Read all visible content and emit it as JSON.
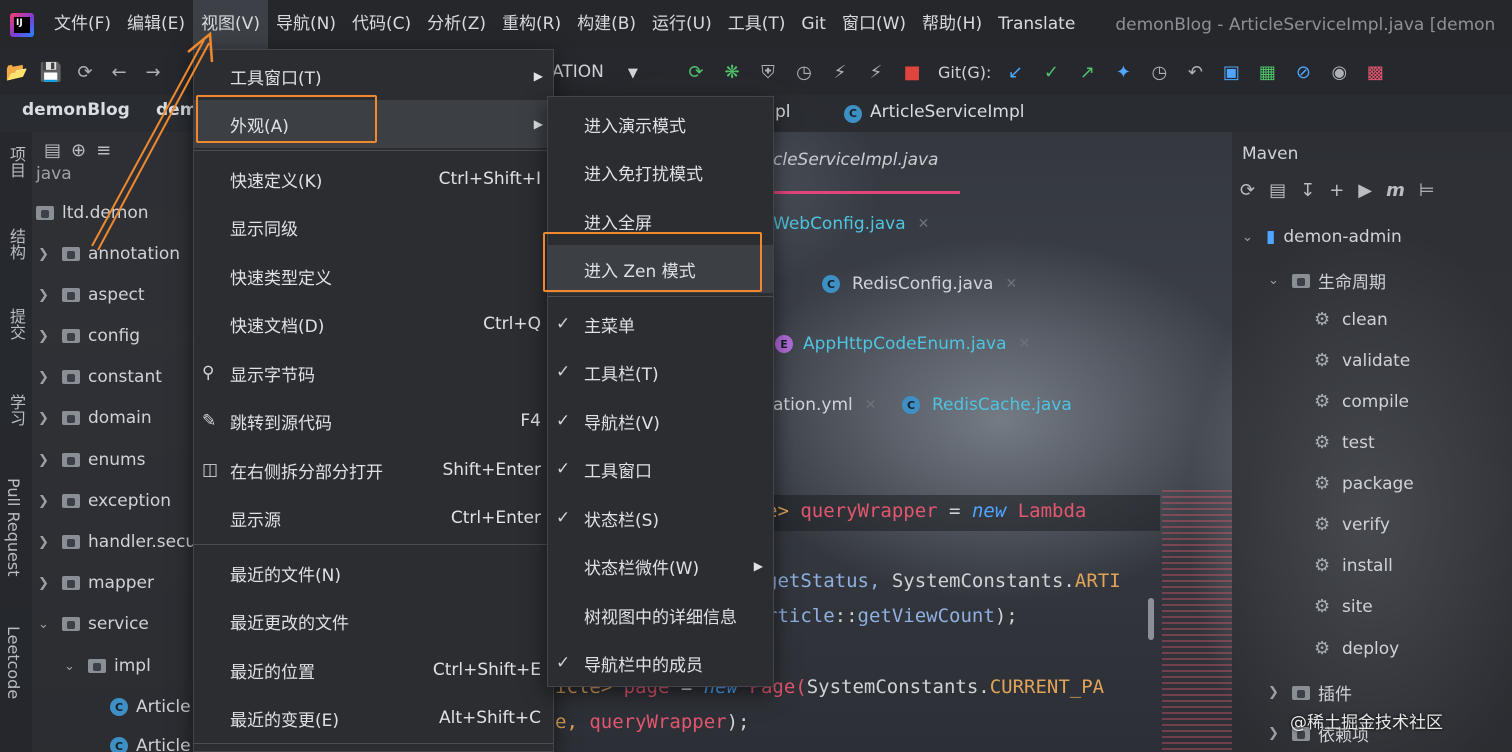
{
  "menubar": {
    "logo_text": "IJ",
    "items": [
      "文件(F)",
      "编辑(E)",
      "视图(V)",
      "导航(N)",
      "代码(C)",
      "分析(Z)",
      "重构(R)",
      "构建(B)",
      "运行(U)",
      "工具(T)",
      "Git",
      "窗口(W)",
      "帮助(H)",
      "Translate"
    ],
    "active_item": "视图(V)",
    "window_title": "demonBlog - ArticleServiceImpl.java [demon"
  },
  "toolbar": {
    "run_config": "ATION",
    "git_label": "Git(G):"
  },
  "breadcrumb": {
    "project": "demonBlog",
    "module": "dem",
    "partial": "pl",
    "class": "ArticleServiceImpl"
  },
  "left_strip": {
    "tabs": [
      "项目",
      "结构",
      "提交",
      "学习",
      "Pull Request",
      "Leetcode"
    ]
  },
  "project_tree": {
    "top_partial": "java",
    "root": "ltd.demon",
    "folders": [
      "annotation",
      "aspect",
      "config",
      "constant",
      "domain",
      "enums",
      "exception",
      "handler.secu",
      "mapper",
      "service"
    ],
    "sub": "impl",
    "files": [
      "Article",
      "Article"
    ]
  },
  "editor": {
    "tabs": [
      {
        "name": "cleServiceImpl.java"
      },
      {
        "name": "WebConfig.java"
      },
      {
        "name": "RedisConfig.java"
      },
      {
        "name": "AppHttpCodeEnum.java"
      },
      {
        "name": "ation.yml"
      },
      {
        "name": "RedisCache.java"
      }
    ],
    "code": {
      "l1_a": "e> ",
      "l1_b": "queryWrapper",
      "l1_c": " = ",
      "l1_d": "new",
      "l1_e": " Lambda",
      "l2_a": "getStatus, ",
      "l2_b": "SystemConstants.",
      "l2_c": "ARTI",
      "l3_a": "rticle",
      "l3_b": "::",
      "l3_c": "getViewCount",
      "l3_d": ");",
      "l4_a": "icle> ",
      "l4_b": "page",
      "l4_c": " = ",
      "l4_d": "new",
      "l4_e": " Page(",
      "l4_f": "SystemConstants.",
      "l4_g": "CURRENT_PA",
      "l5_a": "e, ",
      "l5_b": "queryWrapper",
      "l5_c": ");"
    }
  },
  "view_menu": {
    "items": [
      {
        "label": "工具窗口(T)",
        "shortcut": "",
        "submenu": true
      },
      {
        "label": "外观(A)",
        "shortcut": "",
        "submenu": true
      },
      {
        "label": "快速定义(K)",
        "shortcut": "Ctrl+Shift+I"
      },
      {
        "label": "显示同级",
        "shortcut": ""
      },
      {
        "label": "快速类型定义",
        "shortcut": ""
      },
      {
        "label": "快速文档(D)",
        "shortcut": "Ctrl+Q"
      },
      {
        "label": "显示字节码",
        "shortcut": ""
      },
      {
        "label": "跳转到源代码",
        "shortcut": "F4"
      },
      {
        "label": "在右侧拆分部分打开",
        "shortcut": "Shift+Enter"
      },
      {
        "label": "显示源",
        "shortcut": "Ctrl+Enter"
      },
      {
        "label": "最近的文件(N)",
        "shortcut": ""
      },
      {
        "label": "最近更改的文件",
        "shortcut": ""
      },
      {
        "label": "最近的位置",
        "shortcut": "Ctrl+Shift+E"
      },
      {
        "label": "最近的变更(E)",
        "shortcut": "Alt+Shift+C"
      }
    ]
  },
  "appearance_menu": {
    "items": [
      {
        "label": "进入演示模式",
        "checked": false
      },
      {
        "label": "进入免打扰模式",
        "checked": false
      },
      {
        "label": "进入全屏",
        "checked": false
      },
      {
        "label": "进入 Zen 模式",
        "checked": false
      },
      {
        "label": "主菜单",
        "checked": true
      },
      {
        "label": "工具栏(T)",
        "checked": true
      },
      {
        "label": "导航栏(V)",
        "checked": true
      },
      {
        "label": "工具窗口",
        "checked": true
      },
      {
        "label": "状态栏(S)",
        "checked": true
      },
      {
        "label": "状态栏微件(W)",
        "checked": false,
        "submenu": true
      },
      {
        "label": "树视图中的详细信息",
        "checked": false
      },
      {
        "label": "导航栏中的成员",
        "checked": true
      }
    ]
  },
  "maven": {
    "title": "Maven",
    "project": "demon-admin",
    "lifecycle": "生命周期",
    "phases": [
      "clean",
      "validate",
      "compile",
      "test",
      "package",
      "verify",
      "install",
      "site",
      "deploy"
    ],
    "plugins": "插件",
    "dependencies": "依赖项"
  },
  "watermark": "@稀土掘金技术社区",
  "colors": {
    "accent_highlight": "#f0892e",
    "tab_active_underline": "#e0457b",
    "keyword_blue": "#4ea6ff",
    "string_pink": "#e2566e"
  }
}
